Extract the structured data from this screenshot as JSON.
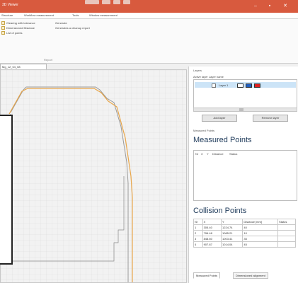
{
  "window": {
    "title": "3D Viewer"
  },
  "menu": [
    "Structure",
    "Workflow measurement",
    "Tools",
    "Window measurement"
  ],
  "ribbon": {
    "items": [
      "Clearing with tolerance",
      "Dimensioned Distance",
      "List of points"
    ],
    "col2": [
      "Generate",
      "Generates a cleanup report"
    ],
    "group_label": "Report"
  },
  "document_tab": "Mg_12_04_08",
  "layers": {
    "panel_title": "Layers",
    "header": "Active layer   Layer name",
    "rows": [
      {
        "name": "Layer 1"
      }
    ],
    "add_button": "Add layer",
    "remove_button": "Remove layer"
  },
  "measured": {
    "panel_title": "Measured Points",
    "title": "Measured Points",
    "columns": [
      "Nr",
      "X",
      "Y",
      "Distance",
      "Status"
    ]
  },
  "collision": {
    "title": "Collision Points",
    "columns": [
      "Nr",
      "X",
      "Y",
      "Distance [mm]",
      "Status"
    ],
    "rows": [
      [
        "1",
        "305.40",
        "1224.74",
        "40",
        ""
      ],
      [
        "2",
        "796.48",
        "1085.21",
        "10",
        ""
      ],
      [
        "3",
        "848.60",
        "1003.41",
        "35",
        ""
      ],
      [
        "4",
        "907.87",
        "1014.04",
        "45",
        ""
      ]
    ]
  },
  "bottom_tabs": [
    "Measured Points",
    "Dimensioned alignment"
  ],
  "colors": {
    "titlebar": "#d85a3e",
    "profile_orange": "#e8a64a",
    "profile_gray": "#9a9a9a",
    "swatch_blue": "#1f5fbf",
    "swatch_red": "#e02020"
  }
}
